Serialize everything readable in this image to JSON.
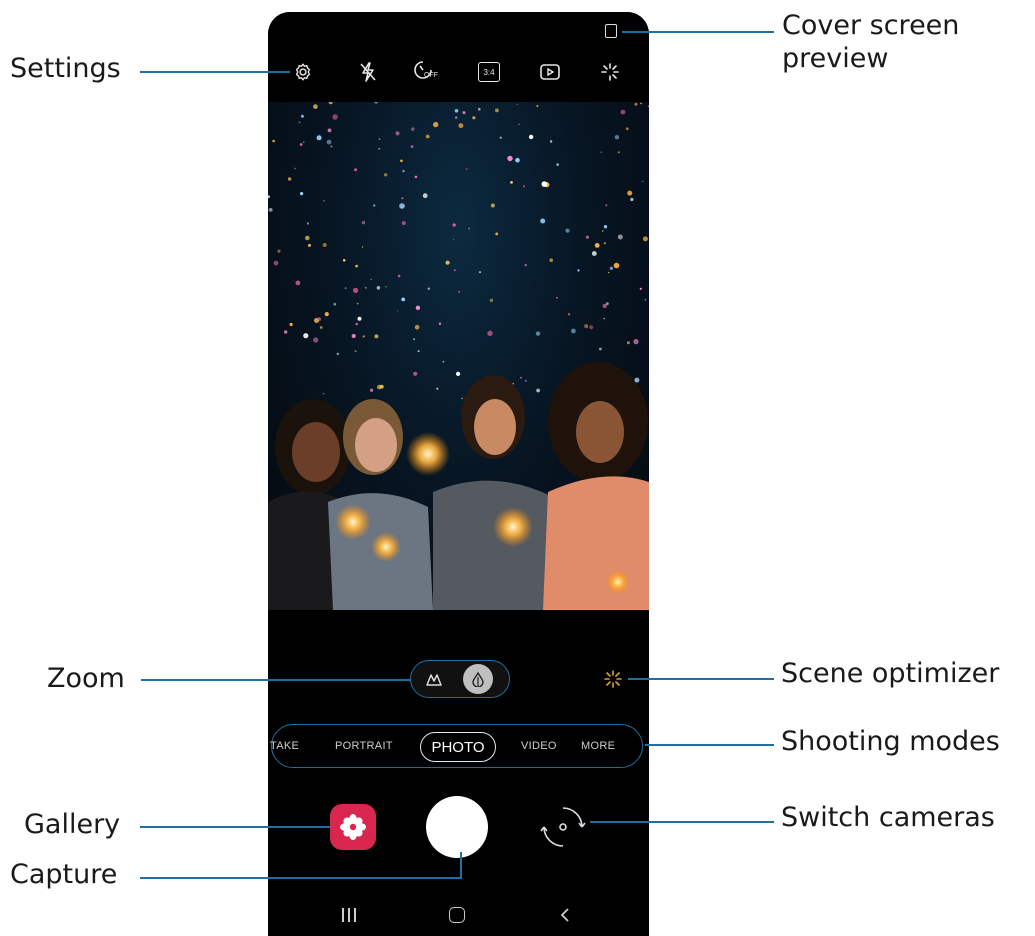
{
  "callouts": {
    "settings": "Settings",
    "cover_screen_preview_line1": "Cover screen",
    "cover_screen_preview_line2": "preview",
    "zoom": "Zoom",
    "scene_optimizer": "Scene optimizer",
    "shooting_modes": "Shooting modes",
    "gallery": "Gallery",
    "switch_cameras": "Switch cameras",
    "capture": "Capture"
  },
  "toolbar": {
    "icons": [
      "gear-icon",
      "flash-off-icon",
      "timer-off-icon",
      "ratio-icon",
      "motion-photo-icon",
      "filter-icon"
    ],
    "timer_label": "OFF",
    "ratio_label": "3:4"
  },
  "modes": {
    "items": [
      "TAKE",
      "PORTRAIT",
      "PHOTO",
      "VIDEO",
      "MORE"
    ],
    "active": "PHOTO"
  },
  "colors": {
    "callout_line": "#1f6fa0",
    "gallery_icon": "#d8264f",
    "capture_button": "#ffffff"
  }
}
